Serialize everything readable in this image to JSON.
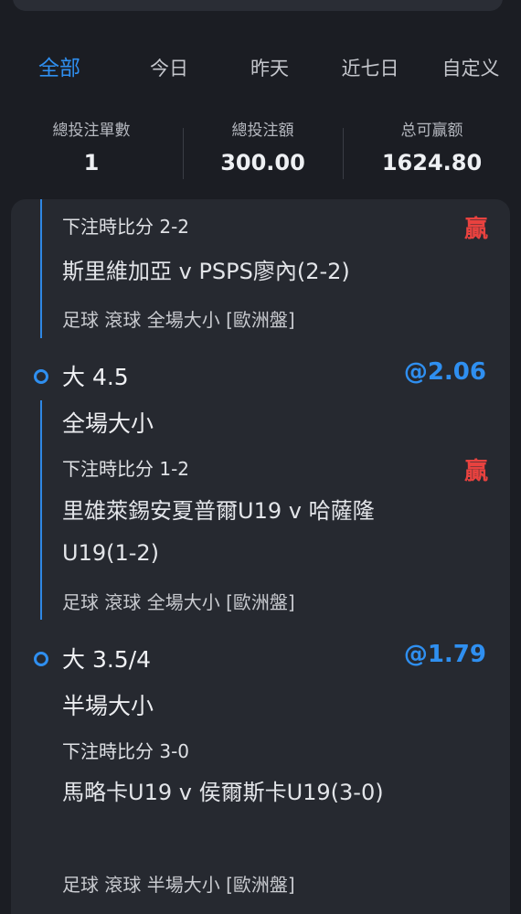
{
  "tabs": [
    {
      "label": "全部",
      "active": true
    },
    {
      "label": "今日",
      "active": false
    },
    {
      "label": "昨天",
      "active": false
    },
    {
      "label": "近七日",
      "active": false
    },
    {
      "label": "自定义",
      "active": false
    }
  ],
  "summary": {
    "bet_count_label": "總投注單數",
    "bet_count_value": "1",
    "bet_amount_label": "總投注額",
    "bet_amount_value": "300.00",
    "win_amount_label": "总可赢额",
    "win_amount_value": "1624.80"
  },
  "bets": [
    {
      "score": "下注時比分 2-2",
      "result": "贏",
      "match": "斯里維加亞 v PSPS廖內(2-2)",
      "meta": "足球 滾球   全場大小 [歐洲盤]"
    },
    {
      "pick": "大 4.5",
      "odds": "@2.06",
      "market": "全場大小",
      "score": "下注時比分 1-2",
      "result": "贏",
      "match": "里雄萊錫安夏普爾U19 v 哈薩隆U19(1-2)",
      "meta": "足球 滾球   全場大小 [歐洲盤]"
    },
    {
      "pick": "大 3.5/4",
      "odds": "@1.79",
      "market": "半場大小",
      "score": "下注時比分 3-0",
      "match": "馬略卡U19 v 侯爾斯卡U19(3-0)",
      "meta": "足球 滾球   半場大小 [歐洲盤]"
    }
  ],
  "colors": {
    "accent": "#2f8ff0",
    "win": "#e8423f",
    "background": "#1b1d23",
    "card": "#262930"
  }
}
